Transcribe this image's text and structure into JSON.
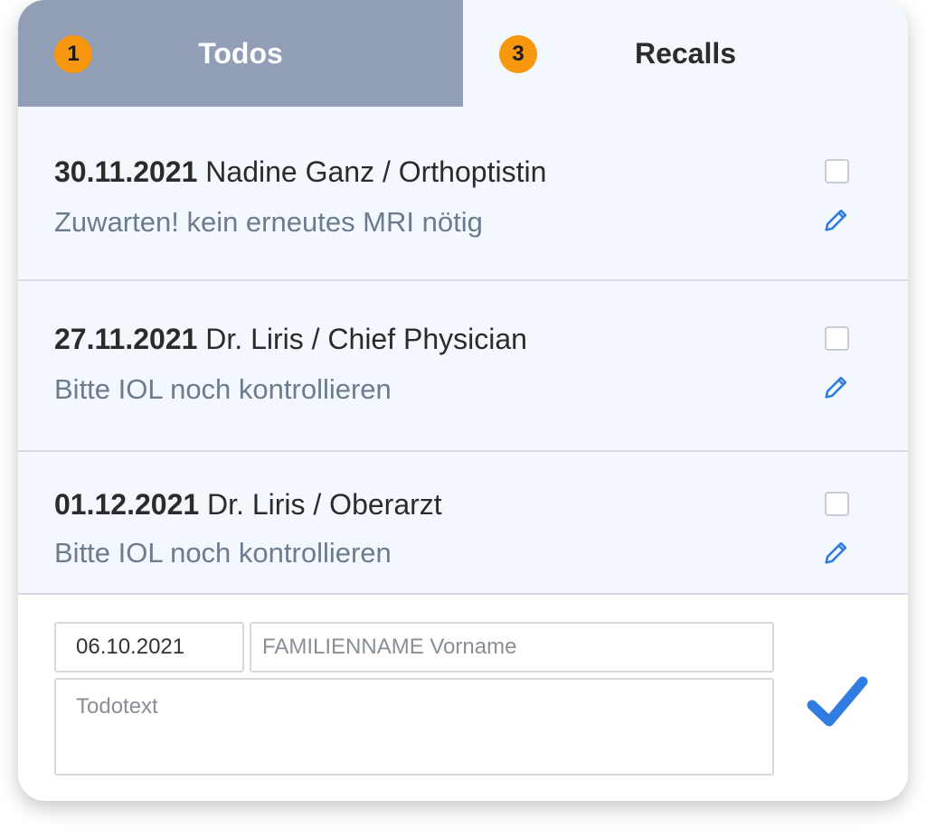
{
  "tabs": [
    {
      "label": "Todos",
      "count": "1"
    },
    {
      "label": "Recalls",
      "count": "3"
    }
  ],
  "items": [
    {
      "date": "30.11.2021",
      "author": "Nadine Ganz / Orthoptistin",
      "text": "Zuwarten! kein erneutes MRI nötig"
    },
    {
      "date": "27.11.2021",
      "author": "Dr. Liris / Chief Physician",
      "text": "Bitte IOL noch kontrollieren"
    },
    {
      "date": "01.12.2021",
      "author": "Dr. Liris / Oberarzt",
      "text": "Bitte IOL noch kontrollieren"
    }
  ],
  "form": {
    "date_value": "06.10.2021",
    "name_placeholder": "FAMILIENNAME Vorname",
    "text_placeholder": "Todotext"
  },
  "icons": {
    "edit": "pencil-icon",
    "confirm": "checkmark-icon"
  },
  "colors": {
    "active_tab": "#919eb5",
    "badge": "#f7960f",
    "accent": "#2f7de1",
    "list_bg": "#f3f8fe"
  }
}
